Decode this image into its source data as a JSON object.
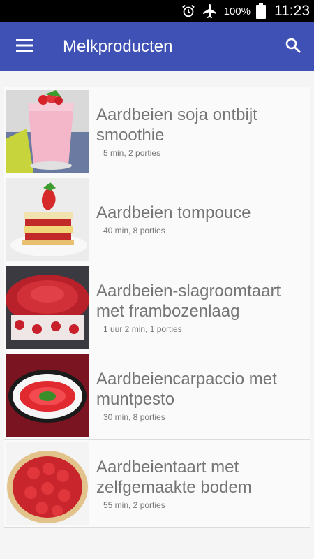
{
  "status_bar": {
    "icons": [
      "alarm-icon",
      "airplane-icon",
      "battery-icon"
    ],
    "battery_label": "100%",
    "time": "11:23"
  },
  "app_bar": {
    "title": "Melkproducten",
    "menu_icon": "menu-icon",
    "search_icon": "search-icon",
    "color": "#3f51b5"
  },
  "recipes": [
    {
      "title_line1": "Aardbeien soja ontbijt",
      "title_line2": "smoothie",
      "meta": "5 min, 2 porties",
      "image": "smoothie-glass-image"
    },
    {
      "title_line1": "Aardbeien tompouce",
      "title_line2": "",
      "meta": "40 min, 8 porties",
      "image": "tompouce-pastry-image"
    },
    {
      "title_line1": "Aardbeien-slagroomtaart",
      "title_line2": "met frambozenlaag",
      "meta": "1 uur 2 min, 1 porties",
      "image": "strawberry-cream-cake-image"
    },
    {
      "title_line1": "Aardbeiencarpaccio met",
      "title_line2": "muntpesto",
      "meta": "30 min, 8 porties",
      "image": "strawberry-carpaccio-plate-image"
    },
    {
      "title_line1": "Aardbeientaart met",
      "title_line2": "zelfgemaakte bodem",
      "meta": "55 min, 2 porties",
      "image": "strawberry-tart-image"
    }
  ]
}
